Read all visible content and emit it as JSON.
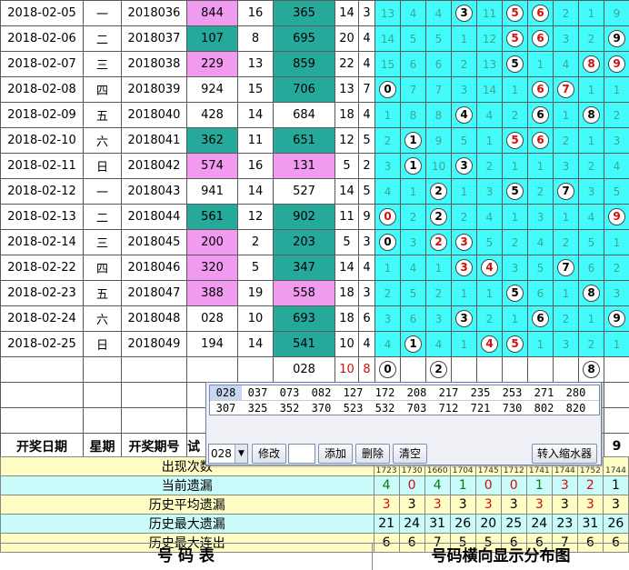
{
  "rows": [
    {
      "date": "2018-02-05",
      "weekday": "一",
      "issue": "2018036",
      "n1": "844",
      "n2": "16",
      "n3": "365",
      "s1": "14",
      "s2": "3",
      "d": [
        "13",
        "4",
        "4",
        {
          "b": "3",
          "c": "blk"
        },
        "11",
        {
          "b": "5",
          "c": "red"
        },
        {
          "b": "6",
          "c": "red"
        },
        "2",
        "1",
        "9"
      ]
    },
    {
      "date": "2018-02-06",
      "weekday": "二",
      "issue": "2018037",
      "n1": "107",
      "n2": "8",
      "n3": "695",
      "s1": "20",
      "s2": "4",
      "d": [
        "14",
        "5",
        "5",
        "1",
        "12",
        {
          "b": "5",
          "c": "red"
        },
        {
          "b": "6",
          "c": "red"
        },
        "3",
        "2",
        {
          "b": "9",
          "c": "blk"
        }
      ]
    },
    {
      "date": "2018-02-07",
      "weekday": "三",
      "issue": "2018038",
      "n1": "229",
      "n2": "13",
      "n3": "859",
      "s1": "22",
      "s2": "4",
      "d": [
        "15",
        "6",
        "6",
        "2",
        "13",
        {
          "b": "5",
          "c": "blk"
        },
        "1",
        "4",
        {
          "b": "8",
          "c": "red"
        },
        {
          "b": "9",
          "c": "red"
        }
      ]
    },
    {
      "date": "2018-02-08",
      "weekday": "四",
      "issue": "2018039",
      "n1": "924",
      "n2": "15",
      "n3": "706",
      "s1": "13",
      "s2": "7",
      "d": [
        {
          "b": "0",
          "c": "blk"
        },
        "7",
        "7",
        "3",
        "14",
        "1",
        {
          "b": "6",
          "c": "red"
        },
        {
          "b": "7",
          "c": "red"
        },
        "1",
        "1"
      ]
    },
    {
      "date": "2018-02-09",
      "weekday": "五",
      "issue": "2018040",
      "n1": "428",
      "n2": "14",
      "n3": "684",
      "s1": "18",
      "s2": "4",
      "d": [
        "1",
        "8",
        "8",
        {
          "b": "4",
          "c": "blk"
        },
        "4",
        "2",
        {
          "b": "6",
          "c": "blk"
        },
        "1",
        {
          "b": "8",
          "c": "blk"
        },
        "2"
      ]
    },
    {
      "date": "2018-02-10",
      "weekday": "六",
      "issue": "2018041",
      "n1": "362",
      "n2": "11",
      "n3": "651",
      "s1": "12",
      "s2": "5",
      "d": [
        "2",
        {
          "b": "1",
          "c": "blk"
        },
        "9",
        "5",
        "1",
        {
          "b": "5",
          "c": "red"
        },
        {
          "b": "6",
          "c": "red"
        },
        "2",
        "1",
        "3"
      ]
    },
    {
      "date": "2018-02-11",
      "weekday": "日",
      "issue": "2018042",
      "n1": "574",
      "n2": "16",
      "n3": "131",
      "s1": "5",
      "s2": "2",
      "d": [
        "3",
        {
          "b": "1",
          "c": "blk"
        },
        "10",
        {
          "b": "3",
          "c": "blk"
        },
        "2",
        "1",
        "1",
        "3",
        "2",
        "4"
      ]
    },
    {
      "date": "2018-02-12",
      "weekday": "一",
      "issue": "2018043",
      "n1": "941",
      "n2": "14",
      "n3": "527",
      "s1": "14",
      "s2": "5",
      "d": [
        "4",
        "1",
        {
          "b": "2",
          "c": "blk"
        },
        "1",
        "3",
        {
          "b": "5",
          "c": "blk"
        },
        "2",
        {
          "b": "7",
          "c": "blk"
        },
        "3",
        "5"
      ]
    },
    {
      "date": "2018-02-13",
      "weekday": "二",
      "issue": "2018044",
      "n1": "561",
      "n2": "12",
      "n3": "902",
      "s1": "11",
      "s2": "9",
      "d": [
        {
          "b": "0",
          "c": "red"
        },
        "2",
        {
          "b": "2",
          "c": "blk"
        },
        "2",
        "4",
        "1",
        "3",
        "1",
        "4",
        {
          "b": "9",
          "c": "red"
        }
      ]
    },
    {
      "date": "2018-02-14",
      "weekday": "三",
      "issue": "2018045",
      "n1": "200",
      "n2": "2",
      "n3": "203",
      "s1": "5",
      "s2": "3",
      "d": [
        {
          "b": "0",
          "c": "blk"
        },
        "3",
        {
          "b": "2",
          "c": "red"
        },
        {
          "b": "3",
          "c": "red"
        },
        "5",
        "2",
        "4",
        "2",
        "5",
        "1"
      ]
    },
    {
      "date": "2018-02-22",
      "weekday": "四",
      "issue": "2018046",
      "n1": "320",
      "n2": "5",
      "n3": "347",
      "s1": "14",
      "s2": "4",
      "d": [
        "1",
        "4",
        "1",
        {
          "b": "3",
          "c": "red"
        },
        {
          "b": "4",
          "c": "red"
        },
        "3",
        "5",
        {
          "b": "7",
          "c": "blk"
        },
        "6",
        "2"
      ]
    },
    {
      "date": "2018-02-23",
      "weekday": "五",
      "issue": "2018047",
      "n1": "388",
      "n2": "19",
      "n3": "558",
      "s1": "18",
      "s2": "3",
      "d": [
        "2",
        "5",
        "2",
        "1",
        "1",
        {
          "b": "5",
          "c": "blk"
        },
        "6",
        "1",
        {
          "b": "8",
          "c": "blk"
        },
        "3"
      ]
    },
    {
      "date": "2018-02-24",
      "weekday": "六",
      "issue": "2018048",
      "n1": "028",
      "n2": "10",
      "n3": "693",
      "s1": "18",
      "s2": "6",
      "d": [
        "3",
        "6",
        "3",
        {
          "b": "3",
          "c": "blk"
        },
        "2",
        "1",
        {
          "b": "6",
          "c": "blk"
        },
        "2",
        "1",
        {
          "b": "9",
          "c": "blk"
        }
      ]
    },
    {
      "date": "2018-02-25",
      "weekday": "日",
      "issue": "2018049",
      "n1": "194",
      "n2": "14",
      "n3": "541",
      "s1": "10",
      "s2": "4",
      "d": [
        "4",
        {
          "b": "1",
          "c": "blk"
        },
        "4",
        "1",
        {
          "b": "4",
          "c": "red"
        },
        {
          "b": "5",
          "c": "red"
        },
        "1",
        "3",
        "2",
        "1"
      ]
    }
  ],
  "pending": {
    "n3": "028",
    "s1": "10",
    "s2": "8",
    "d": [
      {
        "b": "0",
        "c": "blk"
      },
      "",
      {
        "b": "2",
        "c": "blk"
      },
      "",
      "",
      "",
      "",
      "",
      {
        "b": "8",
        "c": "blk"
      },
      ""
    ]
  },
  "header": {
    "date": "开奖日期",
    "weekday": "星期",
    "issue": "开奖期号",
    "test": "试",
    "last": "9"
  },
  "popup": {
    "row1": [
      "028",
      "037",
      "073",
      "082",
      "127",
      "172",
      "208",
      "217",
      "235",
      "253",
      "271",
      "280"
    ],
    "row2": [
      "307",
      "325",
      "352",
      "370",
      "523",
      "532",
      "703",
      "712",
      "721",
      "730",
      "802",
      "820"
    ],
    "combo_value": "028",
    "combo_arrow": "▼",
    "btn_modify": "修改",
    "btn_add": "添加",
    "btn_delete": "删除",
    "btn_clear": "清空",
    "btn_transfer": "转入缩水器"
  },
  "partial_counts": [
    "1723",
    "1730",
    "1660",
    "1704",
    "1745",
    "1712",
    "1741",
    "1744",
    "1752",
    "1744"
  ],
  "stats": [
    {
      "label": "出现次数",
      "values": [
        "",
        "",
        "",
        "",
        "",
        "",
        "",
        "",
        "",
        ""
      ]
    },
    {
      "label": "当前遗漏",
      "values": [
        "4",
        "0",
        "4",
        "1",
        "0",
        "0",
        "1",
        "3",
        "2",
        "1"
      ]
    },
    {
      "label": "历史平均遗漏",
      "values": [
        "3",
        "3",
        "3",
        "3",
        "3",
        "3",
        "3",
        "3",
        "3",
        "3"
      ]
    },
    {
      "label": "历史最大遗漏",
      "values": [
        "21",
        "24",
        "31",
        "26",
        "20",
        "25",
        "24",
        "23",
        "31",
        "26"
      ]
    },
    {
      "label": "历史最大连出",
      "values": [
        "6",
        "6",
        "7",
        "5",
        "5",
        "6",
        "6",
        "7",
        "6",
        "6"
      ]
    }
  ],
  "footer": {
    "left": "号   码   表",
    "right": "号码横向显示分布图"
  },
  "colors": {
    "pink": "#f09af0",
    "teal": "#24a99b",
    "cyan": "#42fbfa",
    "red": "#d01010"
  }
}
